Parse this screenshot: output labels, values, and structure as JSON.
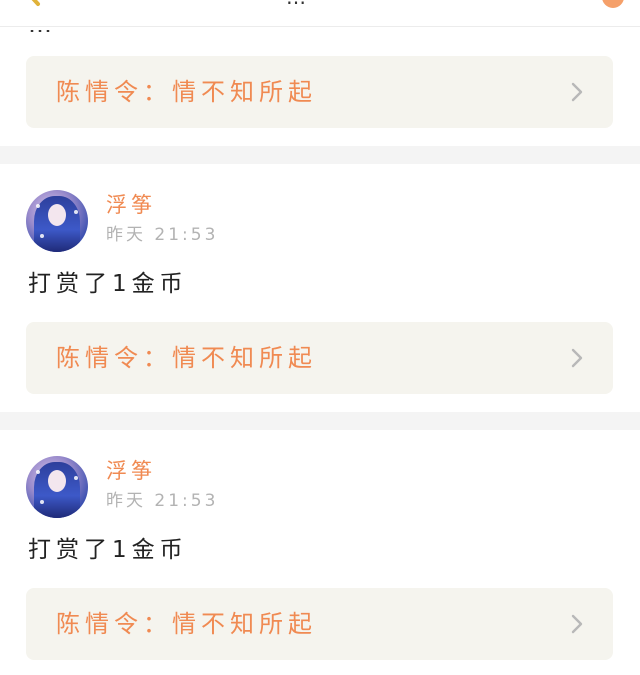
{
  "header": {
    "title_fragment": "…"
  },
  "top_fragment": {
    "text": "…"
  },
  "first_link": {
    "title": "陈情令：情不知所起"
  },
  "posts": [
    {
      "username": "浮筝",
      "timestamp": "昨天 21:53",
      "text": "打赏了1金币",
      "link_title": "陈情令：情不知所起"
    },
    {
      "username": "浮筝",
      "timestamp": "昨天 21:53",
      "text": "打赏了1金币",
      "link_title": "陈情令：情不知所起"
    }
  ],
  "colors": {
    "accent": "#f08a52",
    "link_bg": "#f5f4ee",
    "divider": "#f4f4f4",
    "timestamp": "#b3b3b3"
  },
  "icons": {
    "chevron": "chevron-right-icon",
    "back": "back-icon"
  }
}
